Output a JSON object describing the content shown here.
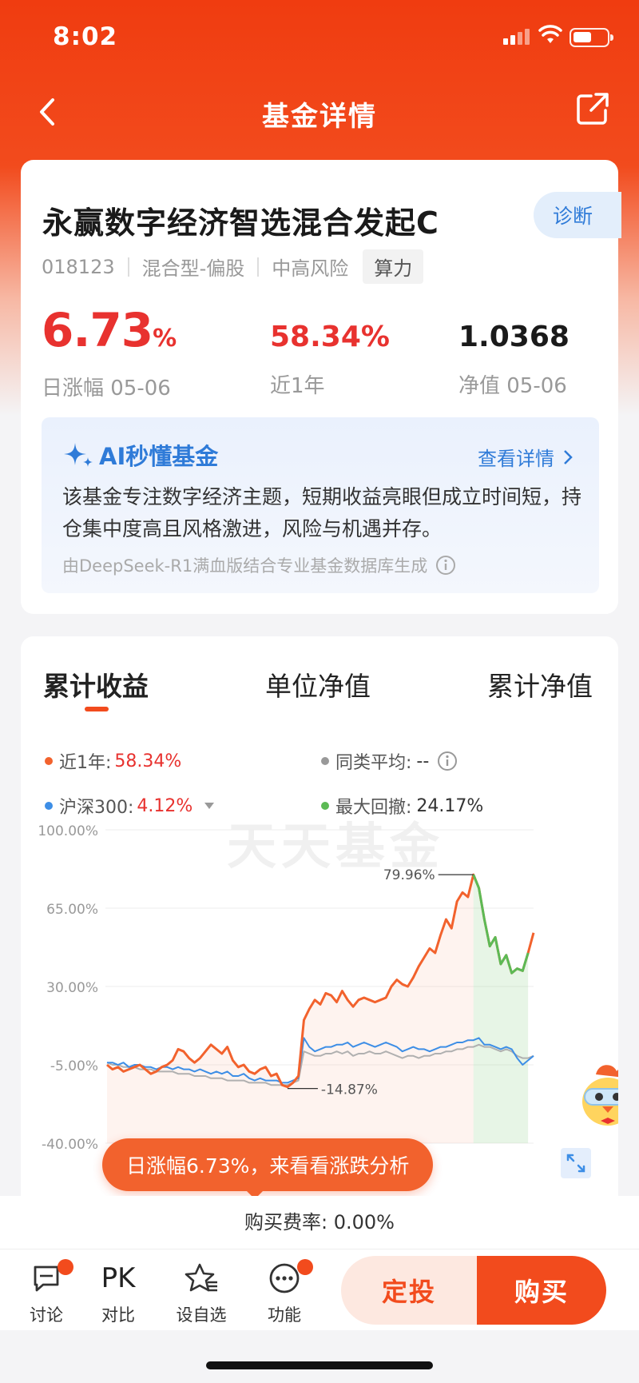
{
  "status": {
    "time": "8:02"
  },
  "nav": {
    "title": "基金详情"
  },
  "fund": {
    "name": "永赢数字经济智选混合发起C",
    "code": "018123",
    "type": "混合型-偏股",
    "risk": "中高风险",
    "tag": "算力",
    "diagnose": "诊断"
  },
  "stats": {
    "daily_value": "6.73",
    "daily_unit": "%",
    "daily_label": "日涨幅 05-06",
    "year_value": "58.34%",
    "year_label": "近1年",
    "nav_value": "1.0368",
    "nav_label": "净值 05-06"
  },
  "ai": {
    "title": "AI秒懂基金",
    "more": "查看详情",
    "text": "该基金专注数字经济主题，短期收益亮眼但成立时间短，持仓集中度高且风格激进，风险与机遇并存。",
    "footer": "由DeepSeek-R1满血版结合专业基金数据库生成"
  },
  "tabs": [
    "累计收益",
    "单位净值",
    "累计净值"
  ],
  "legend": {
    "fund_label": "近1年:",
    "fund_value": "58.34%",
    "peer_label": "同类平均:",
    "peer_value": "--",
    "index_label": "沪深300:",
    "index_value": "4.12%",
    "drawdown_label": "最大回撤:",
    "drawdown_value": "24.17%"
  },
  "chart": {
    "watermark": "天天基金",
    "y_ticks": [
      "100.00%",
      "65.00%",
      "30.00%",
      "-5.00%",
      "-40.00%"
    ],
    "max_label": "79.96%",
    "min_label": "-14.87%",
    "bubble": "日涨幅6.73%，来看看涨跌分析"
  },
  "chart_data": {
    "type": "line",
    "ylim": [
      -40,
      100
    ],
    "yticks": [
      100,
      65,
      30,
      -5,
      -40
    ],
    "series": [
      {
        "name": "近1年",
        "color": "#f2622d",
        "values": [
          -5,
          -7,
          -6,
          -8,
          -7,
          -6,
          -5,
          -7,
          -9,
          -8,
          -6,
          -5,
          -3,
          2,
          1,
          -2,
          -4,
          -2,
          1,
          4,
          2,
          0,
          3,
          -3,
          -6,
          -5,
          -8,
          -9,
          -7,
          -6,
          -10,
          -9,
          -14,
          -14.87,
          -13,
          -10,
          15,
          20,
          24,
          22,
          27,
          26,
          23,
          28,
          24,
          21,
          24,
          25,
          24,
          23,
          24,
          25,
          30,
          33,
          31,
          30,
          34,
          39,
          43,
          47,
          45,
          53,
          60,
          56,
          68,
          72,
          70,
          79.96,
          74,
          60,
          48,
          52,
          40,
          44,
          36,
          38,
          37,
          45,
          54
        ]
      },
      {
        "name": "沪深300",
        "color": "#3d8ee6",
        "values": [
          -4,
          -4,
          -5,
          -4,
          -6,
          -5,
          -5,
          -6,
          -6,
          -7,
          -6,
          -6,
          -7,
          -6,
          -7,
          -7,
          -8,
          -7,
          -8,
          -9,
          -8,
          -9,
          -8,
          -10,
          -10,
          -9,
          -11,
          -12,
          -11,
          -12,
          -12,
          -12,
          -13,
          -13,
          -12,
          -11,
          7,
          3,
          1,
          2,
          3,
          3,
          4,
          4,
          5,
          3,
          4,
          5,
          4,
          3,
          4,
          5,
          4,
          3,
          1,
          2,
          3,
          2,
          2,
          1,
          2,
          3,
          3,
          4,
          5,
          5,
          6,
          6,
          7,
          4,
          4,
          3,
          2,
          3,
          2,
          -2,
          -5,
          -3,
          -1
        ]
      },
      {
        "name": "同类平均",
        "color": "#b0b0b0",
        "values": [
          -4,
          -5,
          -5,
          -6,
          -6,
          -6,
          -7,
          -7,
          -7,
          -8,
          -8,
          -8,
          -8,
          -9,
          -9,
          -9,
          -10,
          -10,
          -10,
          -11,
          -11,
          -11,
          -12,
          -12,
          -12,
          -12,
          -13,
          -13,
          -13,
          -13,
          -14,
          -14,
          -14,
          -14,
          -13,
          -12,
          1,
          0,
          -1,
          -1,
          0,
          0,
          1,
          0,
          1,
          -1,
          0,
          0,
          1,
          0,
          0,
          1,
          0,
          -1,
          -2,
          -1,
          -1,
          -2,
          -1,
          -1,
          0,
          0,
          1,
          1,
          2,
          2,
          3,
          3,
          4,
          3,
          3,
          2,
          1,
          2,
          1,
          -1,
          -2,
          -2,
          -1
        ]
      }
    ],
    "max_drawdown": {
      "value": 24.17,
      "color": "#5cba55"
    }
  }
}
